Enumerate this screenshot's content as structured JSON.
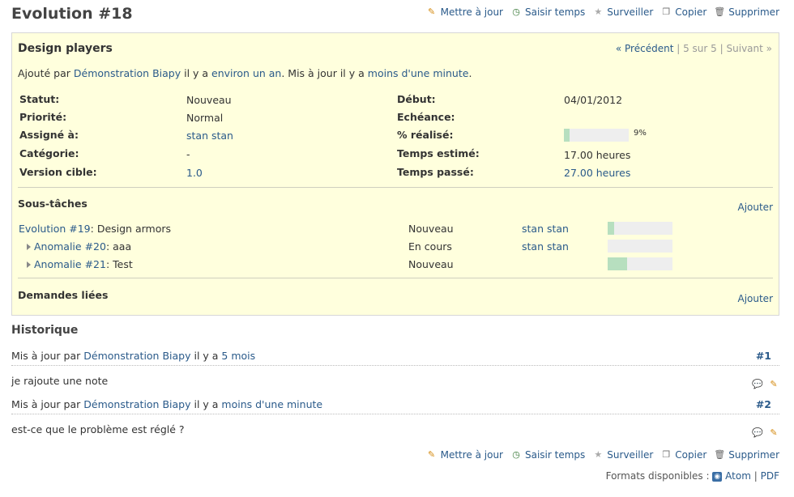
{
  "page": {
    "title": "Evolution #18"
  },
  "actions": {
    "update": "Mettre à jour",
    "log_time": "Saisir temps",
    "watch": "Surveiller",
    "copy": "Copier",
    "delete": "Supprimer"
  },
  "issue": {
    "subject": "Design players",
    "pager": {
      "prev": "« Précédent",
      "sep1": "|",
      "position": "5 sur 5",
      "sep2": "|",
      "next": "Suivant »"
    },
    "author_line": {
      "added_by": "Ajouté par",
      "author": "Démonstration Biapy",
      "ago": "il y a",
      "created": "environ un an",
      "updated_prefix": ". Mis à jour il y a",
      "updated": "moins d'une minute",
      "end": "."
    },
    "attributes_left": [
      {
        "label": "Statut:",
        "value": "Nouveau"
      },
      {
        "label": "Priorité:",
        "value": "Normal"
      },
      {
        "label": "Assigné à:",
        "value": "stan stan"
      },
      {
        "label": "Catégorie:",
        "value": "-"
      },
      {
        "label": "Version cible:",
        "value": "1.0"
      }
    ],
    "attributes_right": [
      {
        "label": "Début:",
        "value": "04/01/2012"
      },
      {
        "label": "Echéance:",
        "value": ""
      },
      {
        "label": "% réalisé:",
        "value": "9%"
      },
      {
        "label": "Temps estimé:",
        "value": "17.00 heures"
      },
      {
        "label": "Temps passé:",
        "value": "27.00 heures"
      }
    ],
    "done_ratio": 0.09,
    "subtasks": {
      "title": "Sous-tâches",
      "add": "Ajouter",
      "rows": [
        {
          "link": "Evolution #19",
          "title": ": Design armors",
          "status": "Nouveau",
          "assignee": "stan stan",
          "progress": 0.1
        },
        {
          "link": "Anomalie #20",
          "title": ": aaa",
          "status": "En cours",
          "assignee": "stan stan",
          "progress": 0.0
        },
        {
          "link": "Anomalie #21",
          "title": ": Test",
          "status": "Nouveau",
          "assignee": "",
          "progress": 0.3
        }
      ]
    },
    "relations": {
      "title": "Demandes liées",
      "add": "Ajouter"
    }
  },
  "history": {
    "title": "Historique",
    "journals": [
      {
        "prefix": "Mis à jour par",
        "author": "Démonstration Biapy",
        "ago": "il y a",
        "time": "5 mois",
        "num": "#1",
        "note": "je rajoute une note"
      },
      {
        "prefix": "Mis à jour par",
        "author": "Démonstration Biapy",
        "ago": "il y a",
        "time": "moins d'une minute",
        "num": "#2",
        "note": "est-ce que le problème est réglé ?"
      }
    ]
  },
  "formats": {
    "label": "Formats disponibles :",
    "atom": "Atom",
    "sep": "|",
    "pdf": "PDF"
  },
  "colors": {
    "issue_bg": "#ffffdd",
    "link": "#2a5a8a",
    "progress_fill": "#b7dfbf"
  }
}
